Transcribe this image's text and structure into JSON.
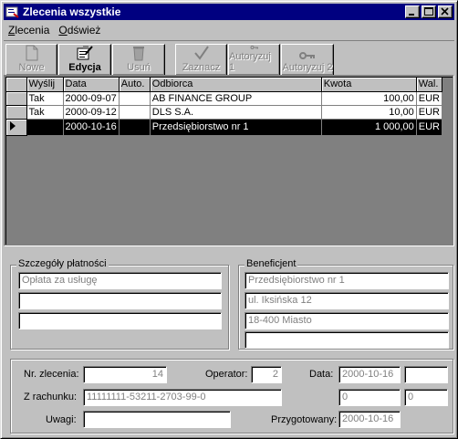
{
  "window": {
    "title": "Zlecenia wszystkie"
  },
  "menu": [
    {
      "label": "Zlecenia"
    },
    {
      "label": "Odśwież"
    }
  ],
  "toolbar": {
    "nowe": "Nowe",
    "edycja": "Edycja",
    "usun": "Usuń",
    "zaznacz": "Zaznacz",
    "autoryzuj1": "Autoryzuj 1",
    "autoryzuj2": "Autoryzuj 2"
  },
  "grid": {
    "columns": [
      "Wyślij",
      "Data",
      "Auto.",
      "Odbiorca",
      "Kwota",
      "Wal."
    ],
    "rows": [
      {
        "wyslij": "Tak",
        "data": "2000-09-07",
        "auto": "",
        "odbiorca": "AB FINANCE GROUP",
        "kwota": "100,00",
        "wal": "EUR",
        "selected": false
      },
      {
        "wyslij": "Tak",
        "data": "2000-09-12",
        "auto": "",
        "odbiorca": "DLS S.A.",
        "kwota": "10,00",
        "wal": "EUR",
        "selected": false
      },
      {
        "wyslij": "",
        "data": "2000-10-16",
        "auto": "",
        "odbiorca": "Przedsiębiorstwo nr 1",
        "kwota": "1 000,00",
        "wal": "EUR",
        "selected": true
      }
    ]
  },
  "szczegoly": {
    "title": "Szczegóły płatności",
    "lines": [
      "Opłata za usługę",
      "",
      ""
    ]
  },
  "beneficjent": {
    "title": "Beneficjent",
    "lines": [
      "Przedsiębiorstwo nr 1",
      "ul. Iksińska 12",
      "18-400 Miasto",
      ""
    ]
  },
  "details": {
    "nr_label": "Nr. zlecenia:",
    "nr_value": "14",
    "operator_label": "Operator:",
    "operator_value": "2",
    "data_label": "Data:",
    "data_value": "2000-10-16",
    "data_extra": "",
    "rachunek_label": "Z rachunku:",
    "rachunek_value": "11111111-53211-2703-99-0",
    "rachunek_extra1": "0",
    "rachunek_extra2": "0",
    "uwagi_label": "Uwagi:",
    "uwagi_value": "",
    "przygotowany_label": "Przygotowany:",
    "przygotowany_value": "2000-10-16"
  }
}
